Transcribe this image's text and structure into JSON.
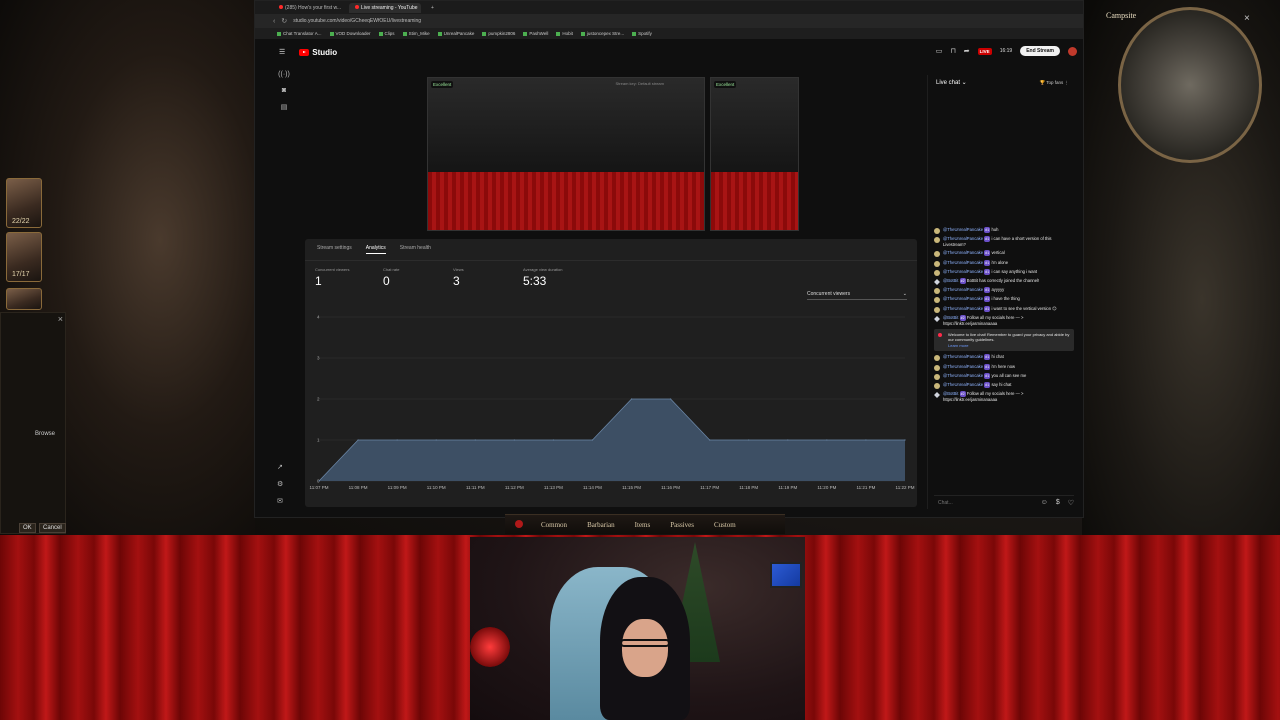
{
  "browser": {
    "tabs": [
      {
        "label": "(285) How's your first w..."
      },
      {
        "label": "Live streaming - YouTube",
        "active": true
      }
    ],
    "url": "studio.youtube.com/video/GCheeqEWfOEU/livestreaming",
    "bookmarks": [
      "Chat Translator A...",
      "VOD Downloader",
      "Clips",
      "Stim_Mike",
      "UnrealPancake",
      "pumpkin2806",
      "PashWell",
      "Hobit",
      "justoncepex Stre...",
      "Spotify"
    ]
  },
  "studio": {
    "brand": "Studio",
    "live_badge": "LIVE",
    "live_time": "16:19",
    "end_stream": "End Stream"
  },
  "previews": {
    "main_badge": "Excellent",
    "stream_key": "Stream key: Default stream",
    "side_badge": "Excellent"
  },
  "analytics": {
    "tabs": [
      "Stream settings",
      "Analytics",
      "Stream health"
    ],
    "metrics": [
      {
        "label": "Concurrent viewers",
        "value": "1"
      },
      {
        "label": "Chat rate",
        "value": "0"
      },
      {
        "label": "Views",
        "value": "3"
      },
      {
        "label": "Average view duration",
        "value": "5:33"
      }
    ],
    "dropdown": "Concurrent viewers"
  },
  "chart_data": {
    "type": "area",
    "x": [
      "11:07 PM",
      "11:08 PM",
      "11:09 PM",
      "11:10 PM",
      "11:11 PM",
      "11:12 PM",
      "11:13 PM",
      "11:14 PM",
      "11:15 PM",
      "11:16 PM",
      "11:17 PM",
      "11:18 PM",
      "11:19 PM",
      "11:20 PM",
      "11:21 PM",
      "11:22 PM"
    ],
    "series": [
      {
        "values": [
          0,
          1,
          1,
          1,
          1,
          1,
          1,
          1,
          2,
          2,
          1,
          1,
          1,
          1,
          1,
          1
        ]
      }
    ],
    "y_ticks": [
      0,
      1,
      2,
      3,
      4
    ],
    "ylim": [
      0,
      4
    ],
    "grid": true,
    "color": "#3d4f64"
  },
  "chat": {
    "title": "Live chat",
    "top_fans": "Top fans",
    "notice": "Welcome to live chat! Remember to guard your privacy and abide by our community guidelines.",
    "notice_link": "Learn more",
    "input_placeholder": "Chat...",
    "messages": [
      {
        "author": "@TheUnrealPancake",
        "badge": "#1",
        "text": "huh"
      },
      {
        "author": "@TheUnrealPancake",
        "badge": "#1",
        "text": "i can have a short version of this Livestream?"
      },
      {
        "author": "@TheUnrealPancake",
        "badge": "#1",
        "text": "vertical"
      },
      {
        "author": "@TheUnrealPancake",
        "badge": "#1",
        "text": "i'm alone"
      },
      {
        "author": "@TheUnrealPancake",
        "badge": "#1",
        "text": "i can say anything i want"
      },
      {
        "author": "@BotBit",
        "badge": "#2",
        "text": "BotBit has correctly joined the channel!",
        "bot": true
      },
      {
        "author": "@TheUnrealPancake",
        "badge": "#1",
        "text": "ayyyyy"
      },
      {
        "author": "@TheUnrealPancake",
        "badge": "#1",
        "text": "i have the thing"
      },
      {
        "author": "@TheUnrealPancake",
        "badge": "#1",
        "text": "i want to see the vertical version 😊"
      },
      {
        "author": "@BotBit",
        "badge": "#2",
        "text": "Follow all my socials here — > https://linktr.ee/jasminanaaaa",
        "bot": true
      }
    ],
    "messages2": [
      {
        "author": "@TheUnrealPancake",
        "badge": "#1",
        "text": "hi chat"
      },
      {
        "author": "@TheUnrealPancake",
        "badge": "#1",
        "text": "i'm here now"
      },
      {
        "author": "@TheUnrealPancake",
        "badge": "#1",
        "text": "you all can see me"
      },
      {
        "author": "@TheUnrealPancake",
        "badge": "#1",
        "text": "say hi chat"
      },
      {
        "author": "@BotBit",
        "badge": "#2",
        "text": "Follow all my socials here — > https://linktr.ee/jasminanaaaa",
        "bot": true
      }
    ]
  },
  "game": {
    "minimap_label": "Campsite",
    "portraits": [
      {
        "label": "22/22"
      },
      {
        "label": "17/17"
      }
    ],
    "dialog_browse": "Browse",
    "dialog_ok": "OK",
    "dialog_cancel": "Cancel",
    "hotbar_tabs": [
      "Common",
      "Barbarian",
      "Items",
      "Passives",
      "Custom"
    ]
  }
}
